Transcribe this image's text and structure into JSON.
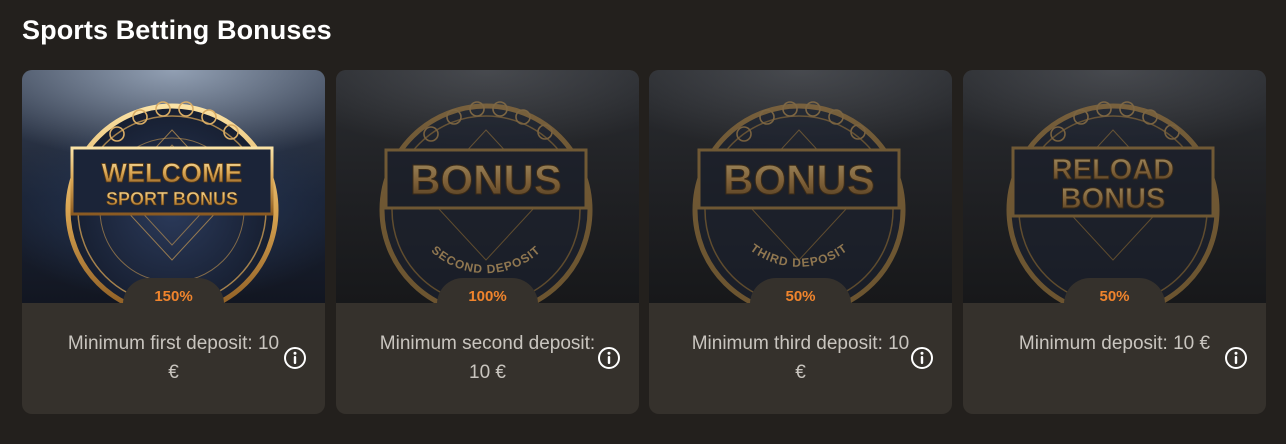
{
  "page": {
    "title": "Sports Betting Bonuses"
  },
  "cards": [
    {
      "badge_line1": "WELCOME",
      "badge_line2": "SPORT BONUS",
      "arc_text": "",
      "percent": "150%",
      "description": "Minimum first deposit: 10 €",
      "info_icon": "info-icon"
    },
    {
      "badge_line1": "BONUS",
      "badge_line2": "",
      "arc_text": "SECOND DEPOSIT",
      "percent": "100%",
      "description": "Minimum second deposit: 10 €",
      "info_icon": "info-icon"
    },
    {
      "badge_line1": "BONUS",
      "badge_line2": "",
      "arc_text": "THIRD DEPOSIT",
      "percent": "50%",
      "description": "Minimum third deposit: 10 €",
      "info_icon": "info-icon"
    },
    {
      "badge_line1": "RELOAD",
      "badge_line2": "BONUS",
      "arc_text": "",
      "percent": "50%",
      "description": "Minimum deposit: 10 €",
      "info_icon": "info-icon"
    }
  ],
  "colors": {
    "background": "#23201d",
    "card": "#35312c",
    "accent_orange": "#f0842c",
    "gold": "#d4a45a",
    "text_muted": "#c9c5bf"
  }
}
